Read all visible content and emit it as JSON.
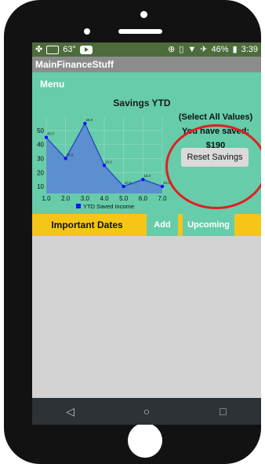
{
  "status_bar": {
    "temperature": "63°",
    "battery": "46%",
    "time": "3:39"
  },
  "app": {
    "title": "MainFinanceStuff",
    "menu_label": "Menu"
  },
  "chart_data": {
    "type": "area",
    "title": "Savings YTD",
    "x": [
      1.0,
      2.0,
      3.0,
      4.0,
      5.0,
      6.0,
      7.0
    ],
    "series": [
      {
        "name": "YTD Saved Income",
        "values": [
          45.0,
          30.0,
          55.0,
          25.0,
          10.0,
          15.0,
          10.0
        ],
        "point_labels": [
          "45.0",
          "30.0",
          "55.0",
          "25.0",
          "10.0",
          "15.0",
          "10.0"
        ]
      }
    ],
    "x_ticks": [
      "1.0",
      "2.0",
      "3.0",
      "4.0",
      "5.0",
      "6.0",
      "7.0"
    ],
    "y_ticks": [
      "10",
      "20",
      "30",
      "40",
      "50"
    ],
    "xlim": [
      1,
      7
    ],
    "ylim": [
      5,
      60
    ],
    "grid": true,
    "legend": "bottom",
    "colors": {
      "fill": "#5b84d6",
      "line": "#1f3fbf",
      "point": "#1010ff"
    }
  },
  "summary": {
    "select_all": "(Select All Values)",
    "saved_label": "You have saved:",
    "saved_amount": "$190",
    "reset_button": "Reset Savings"
  },
  "tabs": {
    "important_dates": "Important Dates",
    "add": "Add",
    "upcoming": "Upcoming"
  },
  "nav": {
    "back": "◁",
    "home": "○",
    "recents": "□"
  },
  "colors": {
    "accent_green": "#66ccaa",
    "accent_yellow": "#f5c518",
    "highlight_red": "#e02020"
  }
}
